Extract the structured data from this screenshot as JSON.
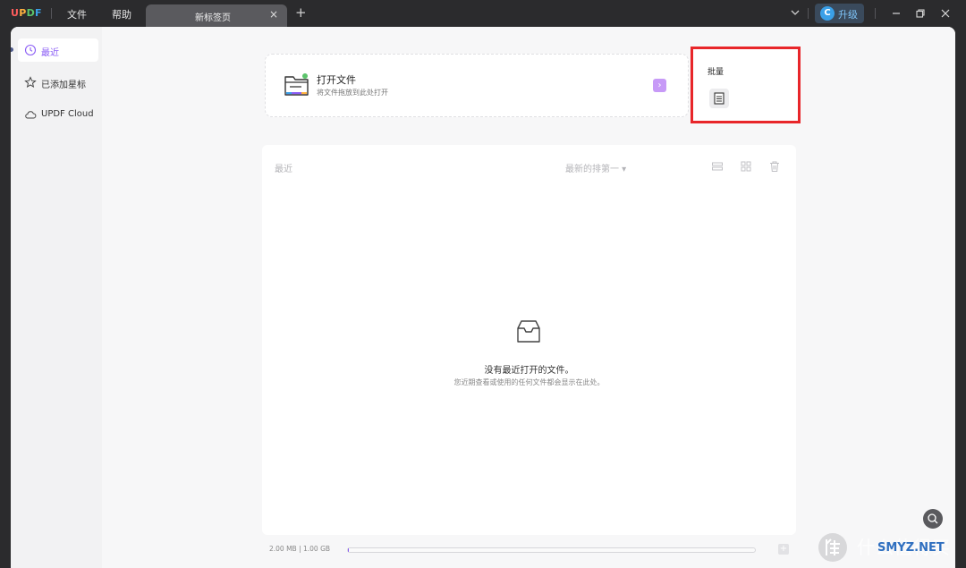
{
  "titlebar": {
    "logo": "UPDF",
    "logo_colors": [
      "#ff5d5d",
      "#ffb23f",
      "#5bc46b",
      "#3aa0e8"
    ],
    "menu": [
      "文件",
      "帮助"
    ],
    "tab_label": "新标签页",
    "tab_close": "×",
    "tab_add": "+",
    "upgrade_avatar": "C",
    "upgrade_label": "升级"
  },
  "sidebar": {
    "items": [
      {
        "label": "最近",
        "icon": "clock-icon",
        "active": true
      },
      {
        "label": "已添加星标",
        "icon": "star-icon",
        "active": false
      },
      {
        "label": "UPDF Cloud",
        "icon": "cloud-icon",
        "active": false
      }
    ]
  },
  "open_file": {
    "title": "打开文件",
    "subtitle": "将文件拖放到此处打开",
    "arrow": "›"
  },
  "batch": {
    "title": "批量",
    "icon": "document-stack-icon"
  },
  "recent": {
    "title": "最近",
    "sort_label": "最新的排第一 ▾",
    "tools": [
      "list-view-icon",
      "grid-view-icon",
      "trash-icon"
    ],
    "empty_icon": "inbox-icon",
    "empty_title": "没有最近打开的文件。",
    "empty_subtitle": "您近期查看或使用的任何文件都会显示在此处。"
  },
  "storage": {
    "text": "2.00 MB | 1.00 GB",
    "used_fraction": 0.002,
    "add": "+"
  },
  "watermark": {
    "text": "什么值得买",
    "site": "SMYZ.NET"
  },
  "colors": {
    "accent": "#8a5cf5",
    "highlight_border": "#e8262a",
    "titlebar_bg": "#2b2b2d"
  }
}
